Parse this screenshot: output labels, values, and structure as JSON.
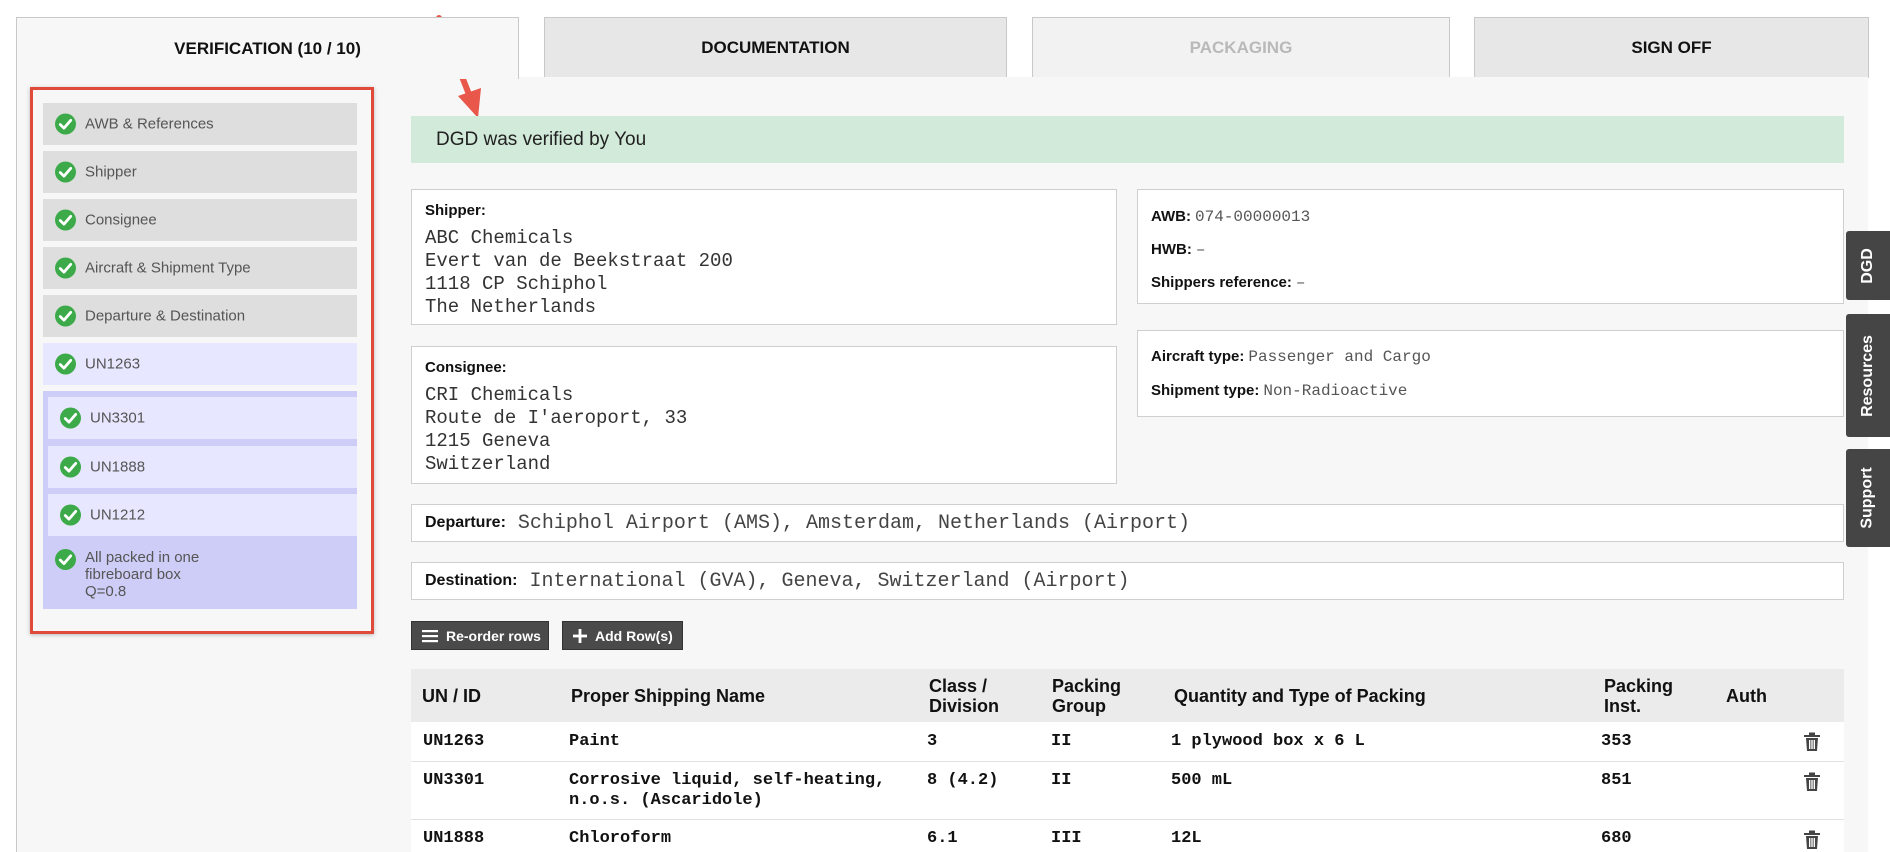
{
  "tabs": [
    {
      "label": "VERIFICATION (10 / 10)",
      "state": "active"
    },
    {
      "label": "DOCUMENTATION",
      "state": "normal"
    },
    {
      "label": "PACKAGING",
      "state": "disabled"
    },
    {
      "label": "SIGN OFF",
      "state": "normal"
    }
  ],
  "sidebar": {
    "items": [
      {
        "label": "AWB & References",
        "status": "verified"
      },
      {
        "label": "Shipper",
        "status": "verified"
      },
      {
        "label": "Consignee",
        "status": "verified"
      },
      {
        "label": "Aircraft & Shipment Type",
        "status": "verified"
      },
      {
        "label": "Departure & Destination",
        "status": "verified"
      },
      {
        "label": "UN1263",
        "status": "verified"
      },
      {
        "label": "UN3301",
        "status": "verified"
      },
      {
        "label": "UN1888",
        "status": "verified"
      },
      {
        "label": "UN1212",
        "status": "verified"
      }
    ],
    "packed_lines": [
      "All packed in one",
      "fibreboard box",
      "Q=0.8"
    ]
  },
  "banner": "DGD was verified by You",
  "shipper": {
    "title": "Shipper:",
    "address": "ABC Chemicals\nEvert van de Beekstraat 200\n1118 CP Schiphol\nThe Netherlands"
  },
  "consignee": {
    "title": "Consignee:",
    "address": "CRI Chemicals\nRoute de I'aeroport, 33\n1215 Geneva\nSwitzerland"
  },
  "references": {
    "awb_label": "AWB:",
    "awb": "074-00000013",
    "hwb_label": "HWB:",
    "hwb": "–",
    "shipref_label": "Shippers reference:",
    "shipref": "–"
  },
  "aircraft": {
    "aircraft_label": "Aircraft type:",
    "aircraft": "Passenger and Cargo",
    "shipment_label": "Shipment type:",
    "shipment": "Non-Radioactive"
  },
  "route": {
    "departure_label": "Departure:",
    "departure": "Schiphol Airport (AMS), Amsterdam, Netherlands (Airport)",
    "destination_label": "Destination:",
    "destination": "International (GVA), Geneva, Switzerland (Airport)"
  },
  "actions": {
    "reorder": "Re-order rows",
    "add_rows": "Add Row(s)"
  },
  "table": {
    "headers": {
      "un_id": "UN / ID",
      "psn": "Proper Shipping Name",
      "class_1": "Class /",
      "class_2": "Division",
      "pg_1": "Packing",
      "pg_2": "Group",
      "qty": "Quantity and Type of Packing",
      "pi_1": "Packing",
      "pi_2": "Inst.",
      "auth": "Auth"
    },
    "rows": [
      {
        "un": "UN1263",
        "psn_1": "Paint",
        "psn_2": "",
        "class": "3",
        "pg": "II",
        "qty": "1 plywood box x 6 L",
        "pi": "353"
      },
      {
        "un": "UN3301",
        "psn_1": "Corrosive liquid, self-heating,",
        "psn_2": "n.o.s. (Ascaridole)",
        "class": "8 (4.2)",
        "pg": "II",
        "qty": "500 mL",
        "pi": "851"
      },
      {
        "un": "UN1888",
        "psn_1": "Chloroform",
        "psn_2": "",
        "class": "6.1",
        "pg": "III",
        "qty": "12L",
        "pi": "680"
      }
    ]
  },
  "side_tabs": {
    "dgd": "DGD",
    "resources": "Resources",
    "support": "Support"
  },
  "colors": {
    "accent_green": "#3daa4a",
    "highlight_red": "#e04a3b",
    "banner_bg": "#d1ead9"
  }
}
